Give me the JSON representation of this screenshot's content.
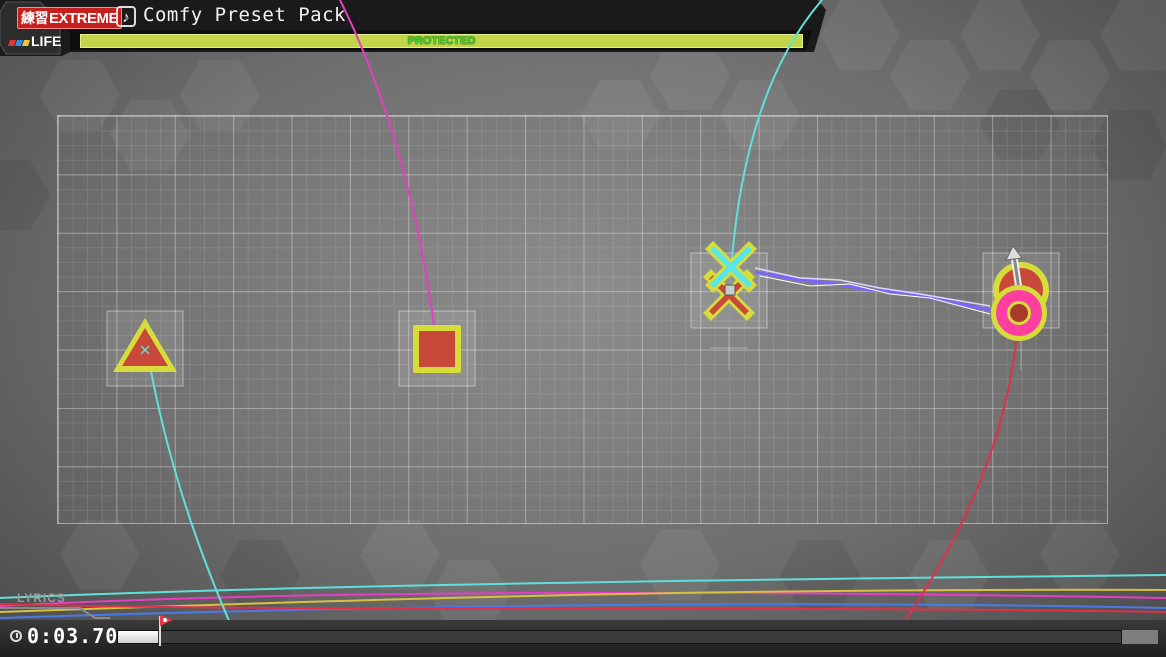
{
  "header": {
    "difficulty_kanji": "練習",
    "difficulty": "EXTREME",
    "song_title": "Comfy Preset Pack",
    "life_label": "LIFE",
    "life_status": "PROTECTED",
    "life_fraction": 1.0
  },
  "notes": [
    {
      "shape": "triangle-icon",
      "color": "#c8493a"
    },
    {
      "shape": "square-icon",
      "color": "#c8493a"
    },
    {
      "shape": "cross-icon",
      "color": "#58e6ea"
    },
    {
      "shape": "circle-icon",
      "color": "#ff3fa0"
    }
  ],
  "footer": {
    "lyrics_label": "LYRICS",
    "time": "0:03.70",
    "progress_fraction": 0.04
  },
  "colors": {
    "life_bar": "#b9cf43",
    "protected_text": "#3ad630",
    "difficulty_badge": "#c61d1d",
    "trail_cyan": "#5fe0d8",
    "trail_pink": "#e43fc4",
    "trail_red": "#e0304a"
  }
}
